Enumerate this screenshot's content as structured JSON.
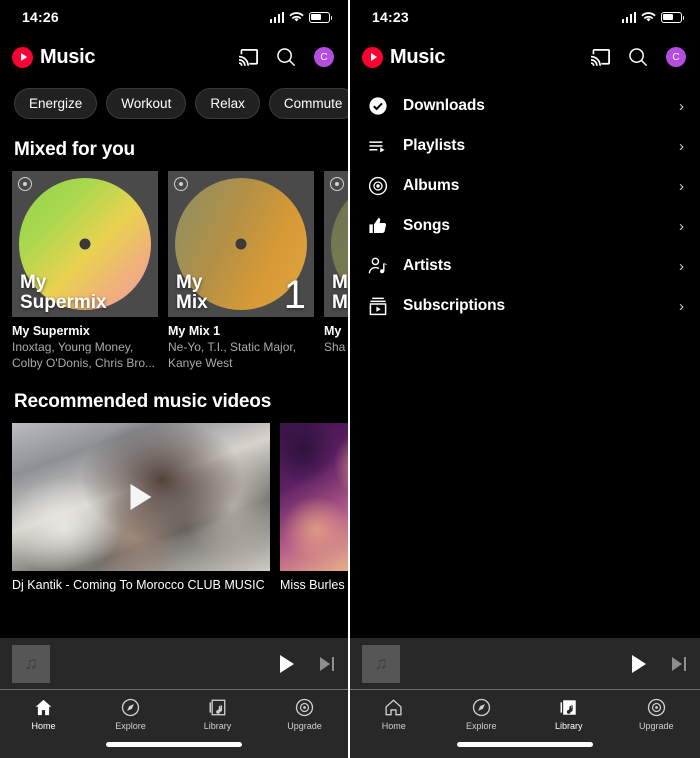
{
  "accent": {
    "brand_red": "#ff0033",
    "avatar_purple": "#b44de0",
    "bg": "#000000",
    "surface": "#282828"
  },
  "left": {
    "status": {
      "time": "14:26",
      "icons": [
        "cellular-signal",
        "wifi",
        "battery"
      ]
    },
    "header": {
      "brand": "Music",
      "logo_icon": "youtube-music-logo",
      "cast_icon": "cast-icon",
      "search_icon": "search-icon",
      "avatar_letter": "C"
    },
    "chips": [
      "Energize",
      "Workout",
      "Relax",
      "Commute"
    ],
    "mixed_section": {
      "title": "Mixed for you",
      "cards": [
        {
          "overlay": "My\nSupermix",
          "overlay_line1": "My",
          "overlay_line2": "Supermix",
          "number": "",
          "title": "My Supermix",
          "subtitle": "Inoxtag, Young Money, Colby O'Donis, Chris Bro...",
          "gradient": "linear-gradient(135deg,#8fd44a 0%,#a9d84e 28%,#e9d24f 55%,#f0b07a 78%,#eda0a8 100%)"
        },
        {
          "overlay_line1": "My",
          "overlay_line2": "Mix",
          "number": "1",
          "title": "My Mix 1",
          "subtitle": "Ne-Yo, T.I., Static Major, Kanye West",
          "gradient": "linear-gradient(115deg,#8a8f66 0%,#b39046 40%,#d79a36 70%,#e0a43f 100%)"
        },
        {
          "overlay_line1": "My",
          "overlay_line2": "M",
          "number": "",
          "title": "My",
          "subtitle": "Sha Mar",
          "gradient": "linear-gradient(135deg,#6e7350 0%,#7d7c52 60%,#8a855a 100%)"
        }
      ]
    },
    "videos_section": {
      "title": "Recommended music videos",
      "cards": [
        {
          "title": "Dj Kantik - Coming To Morocco CLUB MUSIC",
          "play_icon": "play-icon"
        },
        {
          "title": "Miss Burles",
          "play_icon": "play-icon"
        }
      ]
    },
    "miniplayer": {
      "art_icon": "music-note-icon",
      "play_icon": "play-icon",
      "next_icon": "skip-next-icon"
    },
    "nav": {
      "active": "Home",
      "items": [
        {
          "label": "Home",
          "icon": "home-icon"
        },
        {
          "label": "Explore",
          "icon": "compass-icon"
        },
        {
          "label": "Library",
          "icon": "library-icon"
        },
        {
          "label": "Upgrade",
          "icon": "upgrade-icon"
        }
      ]
    }
  },
  "right": {
    "status": {
      "time": "14:23",
      "icons": [
        "cellular-signal",
        "wifi",
        "battery"
      ]
    },
    "header": {
      "brand": "Music",
      "logo_icon": "youtube-music-logo",
      "cast_icon": "cast-icon",
      "search_icon": "search-icon",
      "avatar_letter": "C"
    },
    "library": {
      "items": [
        {
          "label": "Downloads",
          "icon": "check-circle-icon",
          "chevron": "›"
        },
        {
          "label": "Playlists",
          "icon": "playlist-play-icon",
          "chevron": "›"
        },
        {
          "label": "Albums",
          "icon": "album-disc-icon",
          "chevron": "›"
        },
        {
          "label": "Songs",
          "icon": "thumbs-up-icon",
          "chevron": "›"
        },
        {
          "label": "Artists",
          "icon": "artist-person-icon",
          "chevron": "›"
        },
        {
          "label": "Subscriptions",
          "icon": "subscriptions-icon",
          "chevron": "›"
        }
      ]
    },
    "miniplayer": {
      "art_icon": "music-note-icon",
      "play_icon": "play-icon",
      "next_icon": "skip-next-icon"
    },
    "nav": {
      "active": "Library",
      "items": [
        {
          "label": "Home",
          "icon": "home-icon"
        },
        {
          "label": "Explore",
          "icon": "compass-icon"
        },
        {
          "label": "Library",
          "icon": "library-icon"
        },
        {
          "label": "Upgrade",
          "icon": "upgrade-icon"
        }
      ]
    }
  }
}
